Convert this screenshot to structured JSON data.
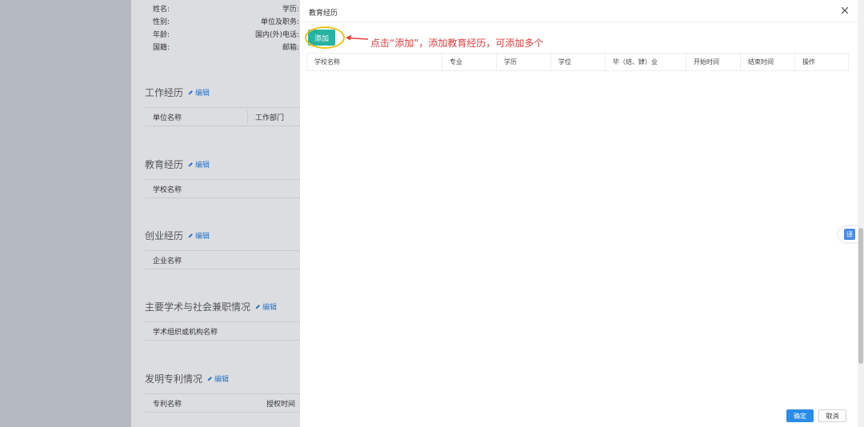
{
  "background": {
    "info_rows": [
      {
        "label": "姓名:",
        "label2": "学历:"
      },
      {
        "label": "性别:",
        "label2": "单位及职务:"
      },
      {
        "label": "年龄:",
        "label2": "国内(外)电话:"
      },
      {
        "label": "国籍:",
        "label2": "邮箱:"
      }
    ],
    "edit_label": "编辑",
    "sections": [
      {
        "title": "工作经历",
        "col1": "单位名称",
        "col2": "工作部门"
      },
      {
        "title": "教育经历",
        "col1": "学校名称",
        "col2": ""
      },
      {
        "title": "创业经历",
        "col1": "企业名称",
        "col2": ""
      },
      {
        "title": "主要学术与社会兼职情况",
        "col1": "学术组织或机构名称",
        "col2": ""
      },
      {
        "title": "发明专利情况",
        "col1": "专利名称",
        "col2": "授权时间"
      }
    ]
  },
  "modal": {
    "title": "教育经历",
    "add_button": "添加",
    "annotation": "点击“添加”，添加教育经历，可添加多个",
    "columns": [
      "学校名称",
      "专业",
      "学历",
      "学位",
      "毕（结、肄）业",
      "开始时间",
      "结束时间",
      "操作"
    ],
    "ok_button": "确定",
    "cancel_button": "取消"
  },
  "translate_float": {
    "label": "译"
  },
  "colors": {
    "accent": "#26b3a1",
    "primary": "#2a8ce9",
    "annotation": "#e23d3d",
    "highlight": "#f2c21b"
  }
}
